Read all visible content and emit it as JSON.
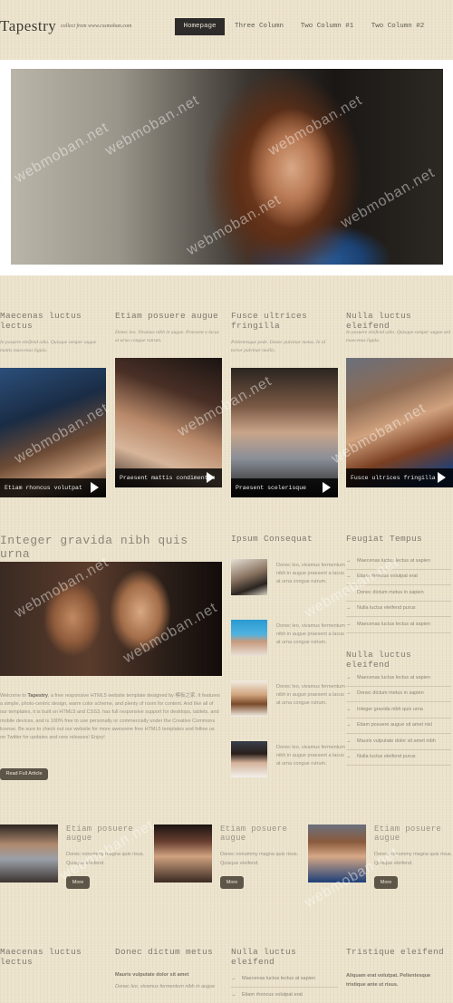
{
  "header": {
    "logo": "Tapestry",
    "tagline": "collect from www.cssmoban.com",
    "nav": [
      "Homepage",
      "Three Column",
      "Two Column #1",
      "Two Column #2"
    ]
  },
  "watermark": "webmoban.net",
  "columns": [
    {
      "title": "Maecenas luctus lectus",
      "desc": "In posuere eleifend odio. Quisque semper augue mattis maecenas ligula.",
      "caption": "Etiam rhoncus volutpat"
    },
    {
      "title": "Etiam posuere augue",
      "desc": "Donec leo. Vivamus nibh in augue. Praesent a lacus at urna congue rutrum.",
      "caption": "Praesent mattis condimentum"
    },
    {
      "title": "Fusce ultrices fringilla",
      "desc": "Pellentesque pede. Donec pulvinar metus. In id tortor pulvinar mollis.",
      "caption": "Praesent scelerisque"
    },
    {
      "title": "Nulla luctus eleifend",
      "desc": "In posuere eleifend odio. Quisque semper augue sed maecenas ligula.",
      "caption": "Fusce ultrices fringilla"
    }
  ],
  "article": {
    "title": "Integer gravida nibh quis urna",
    "body_pre": "Welcome to ",
    "body_strong": "Tapestry",
    "body_post": ", a free responsive HTML5 website template designed by 模板之家. It features a simple, photo-centric design, warm color scheme, and plenty of room for content. And like all of our templates, it is built on HTML5 and CSS3, has full responsive support for desktops, tablets, and mobile devices, and is 100% free to use personally or commercially under the Creative Commons license. Be sure to check out our website for more awesome free HTML5 templates and follow us on Twitter for updates and new releases! Enjoy!",
    "button": "Read Full Article"
  },
  "ipsum": {
    "title": "Ipsum Consequat",
    "item_text": "Donec leo, vivamus fermentum nibh in augue praesent a lacus at urna congue rutrum."
  },
  "feugiat": {
    "title": "Feugiat Tempus",
    "items": [
      "Maecenas luctus lectus at sapien",
      "Etiam rhoncus volutpat erat",
      "Donec dictum metus in sapien",
      "Nulla luctus eleifend purus",
      "Maecenas luctus lectus at sapien"
    ]
  },
  "nulla": {
    "title": "Nulla luctus eleifend",
    "items": [
      "Maecenas luctus lectus at sapien",
      "Donec dictum metus in sapien",
      "Integer gravida nibh quis urna",
      "Etiam posuere augue sit amet nisl",
      "Mauris vulputate dolor sit amet nibh",
      "Nulla luctus eleifend purus"
    ]
  },
  "features": [
    {
      "title": "Etiam posuere augue",
      "desc": "Donec nonummy magna quis risus. Quisque eleifend.",
      "button": "More"
    },
    {
      "title": "Etiam posuere augue",
      "desc": "Donec nonummy magna quis risus. Quisque eleifend.",
      "button": "More"
    },
    {
      "title": "Etiam posuere augue",
      "desc": "Donec nonummy magna quis risus. Quisque eleifend.",
      "button": "More"
    }
  ],
  "footer": {
    "col1_title": "Maecenas luctus lectus",
    "col2_title": "Donec dictum metus",
    "col2_sub": "Mauris vulputate dolor sit amet",
    "col2_text": "Donec leo, vivamus fermentum nibh in augue",
    "col3_title": "Nulla luctus eleifend",
    "col3_items": [
      "Maecenas luctus lectus at sapien",
      "Etiam rhoncus volutpat erat"
    ],
    "col4_title": "Tristique eleifend",
    "col4_text": "Aliquam erat volutpat. Pellentesque tristique ante ut risus."
  }
}
